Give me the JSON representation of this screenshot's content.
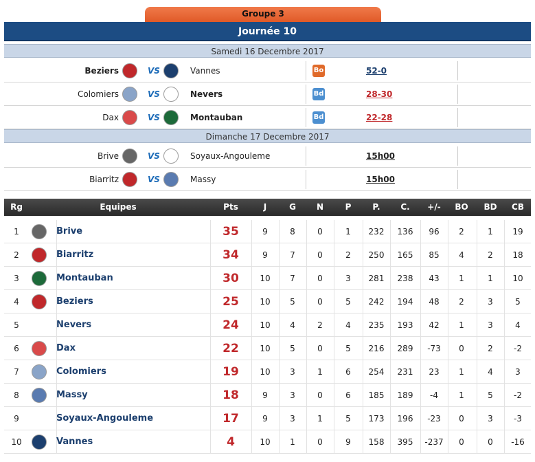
{
  "header": {
    "group": "Groupe 3",
    "journee": "Journée 10"
  },
  "dates": [
    "Samedi 16 Decembre 2017",
    "Dimanche 17 Decembre 2017"
  ],
  "vs_label": "VS",
  "matches": [
    {
      "home": "Beziers",
      "away": "Vannes",
      "winner": "home",
      "badge": "Bo",
      "score": "52-0",
      "score_color": "blue",
      "home_logo": "#c0282b",
      "away_logo": "#1c3f6e"
    },
    {
      "home": "Colomiers",
      "away": "Nevers",
      "winner": "away",
      "badge": "Bd",
      "score": "28-30",
      "score_color": "red",
      "home_logo": "#8aa4c8",
      "away_logo": "#ffffff"
    },
    {
      "home": "Dax",
      "away": "Montauban",
      "winner": "away",
      "badge": "Bd",
      "score": "22-28",
      "score_color": "red",
      "home_logo": "#d94a4a",
      "away_logo": "#1d6a3a"
    },
    {
      "home": "Brive",
      "away": "Soyaux-Angouleme",
      "winner": "none",
      "badge": "",
      "score": "15h00",
      "score_color": "dark",
      "home_logo": "#666666",
      "away_logo": "#ffffff"
    },
    {
      "home": "Biarritz",
      "away": "Massy",
      "winner": "none",
      "badge": "",
      "score": "15h00",
      "score_color": "dark",
      "home_logo": "#c0282b",
      "away_logo": "#5a7bb0"
    }
  ],
  "table": {
    "headers": [
      "Rg",
      "Equipes",
      "Pts",
      "J",
      "G",
      "N",
      "P",
      "P.",
      "C.",
      "+/-",
      "BO",
      "BD",
      "CB"
    ],
    "rows": [
      {
        "rg": "1",
        "team": "Brive",
        "pts": "35",
        "j": "9",
        "g": "8",
        "n": "0",
        "p": "1",
        "pp": "232",
        "c": "136",
        "diff": "96",
        "bo": "2",
        "bd": "1",
        "cb": "19",
        "logo": "#666666"
      },
      {
        "rg": "2",
        "team": "Biarritz",
        "pts": "34",
        "j": "9",
        "g": "7",
        "n": "0",
        "p": "2",
        "pp": "250",
        "c": "165",
        "diff": "85",
        "bo": "4",
        "bd": "2",
        "cb": "18",
        "logo": "#c0282b"
      },
      {
        "rg": "3",
        "team": "Montauban",
        "pts": "30",
        "j": "10",
        "g": "7",
        "n": "0",
        "p": "3",
        "pp": "281",
        "c": "238",
        "diff": "43",
        "bo": "1",
        "bd": "1",
        "cb": "10",
        "logo": "#1d6a3a"
      },
      {
        "rg": "4",
        "team": "Beziers",
        "pts": "25",
        "j": "10",
        "g": "5",
        "n": "0",
        "p": "5",
        "pp": "242",
        "c": "194",
        "diff": "48",
        "bo": "2",
        "bd": "3",
        "cb": "5",
        "logo": "#c0282b"
      },
      {
        "rg": "5",
        "team": "Nevers",
        "pts": "24",
        "j": "10",
        "g": "4",
        "n": "2",
        "p": "4",
        "pp": "235",
        "c": "193",
        "diff": "42",
        "bo": "1",
        "bd": "3",
        "cb": "4",
        "logo": ""
      },
      {
        "rg": "6",
        "team": "Dax",
        "pts": "22",
        "j": "10",
        "g": "5",
        "n": "0",
        "p": "5",
        "pp": "216",
        "c": "289",
        "diff": "-73",
        "bo": "0",
        "bd": "2",
        "cb": "-2",
        "logo": "#d94a4a"
      },
      {
        "rg": "7",
        "team": "Colomiers",
        "pts": "19",
        "j": "10",
        "g": "3",
        "n": "1",
        "p": "6",
        "pp": "254",
        "c": "231",
        "diff": "23",
        "bo": "1",
        "bd": "4",
        "cb": "3",
        "logo": "#8aa4c8"
      },
      {
        "rg": "8",
        "team": "Massy",
        "pts": "18",
        "j": "9",
        "g": "3",
        "n": "0",
        "p": "6",
        "pp": "185",
        "c": "189",
        "diff": "-4",
        "bo": "1",
        "bd": "5",
        "cb": "-2",
        "logo": "#5a7bb0"
      },
      {
        "rg": "9",
        "team": "Soyaux-Angouleme",
        "pts": "17",
        "j": "9",
        "g": "3",
        "n": "1",
        "p": "5",
        "pp": "173",
        "c": "196",
        "diff": "-23",
        "bo": "0",
        "bd": "3",
        "cb": "-3",
        "logo": ""
      },
      {
        "rg": "10",
        "team": "Vannes",
        "pts": "4",
        "j": "10",
        "g": "1",
        "n": "0",
        "p": "9",
        "pp": "158",
        "c": "395",
        "diff": "-237",
        "bo": "0",
        "bd": "0",
        "cb": "-16",
        "logo": "#1c3f6e"
      }
    ]
  }
}
